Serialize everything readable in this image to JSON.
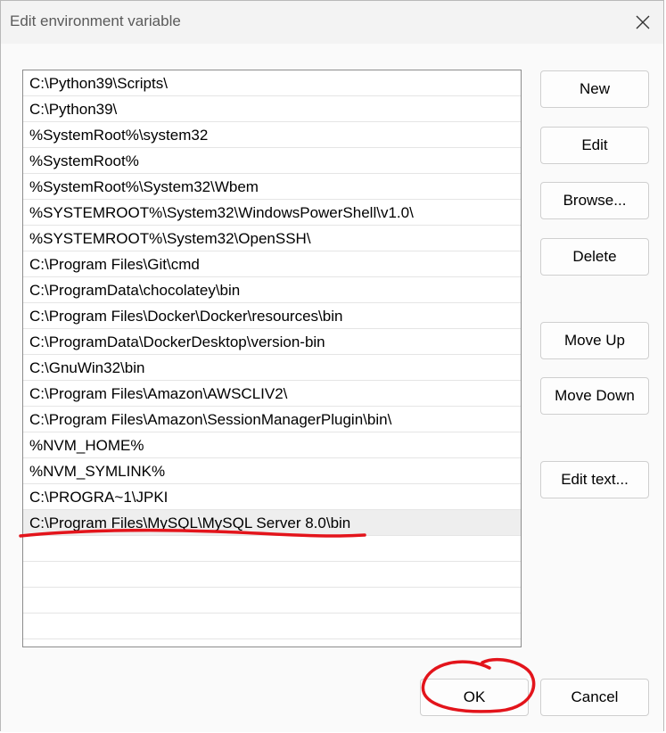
{
  "window": {
    "title": "Edit environment variable"
  },
  "list": {
    "items": [
      "C:\\Python39\\Scripts\\",
      "C:\\Python39\\",
      "%SystemRoot%\\system32",
      "%SystemRoot%",
      "%SystemRoot%\\System32\\Wbem",
      "%SYSTEMROOT%\\System32\\WindowsPowerShell\\v1.0\\",
      "%SYSTEMROOT%\\System32\\OpenSSH\\",
      "C:\\Program Files\\Git\\cmd",
      "C:\\ProgramData\\chocolatey\\bin",
      "C:\\Program Files\\Docker\\Docker\\resources\\bin",
      "C:\\ProgramData\\DockerDesktop\\version-bin",
      "C:\\GnuWin32\\bin",
      "C:\\Program Files\\Amazon\\AWSCLIV2\\",
      "C:\\Program Files\\Amazon\\SessionManagerPlugin\\bin\\",
      "%NVM_HOME%",
      "%NVM_SYMLINK%",
      "C:\\PROGRA~1\\JPKI",
      "C:\\Program Files\\MySQL\\MySQL Server 8.0\\bin"
    ],
    "selected_index": 17,
    "empty_rows": 4
  },
  "buttons": {
    "new": "New",
    "edit": "Edit",
    "browse": "Browse...",
    "delete": "Delete",
    "move_up": "Move Up",
    "move_down": "Move Down",
    "edit_text": "Edit text..."
  },
  "footer": {
    "ok": "OK",
    "cancel": "Cancel"
  },
  "colors": {
    "annotation": "#e3141b",
    "selected_row": "#eeeeee"
  },
  "icons": {
    "close": "close-icon"
  }
}
